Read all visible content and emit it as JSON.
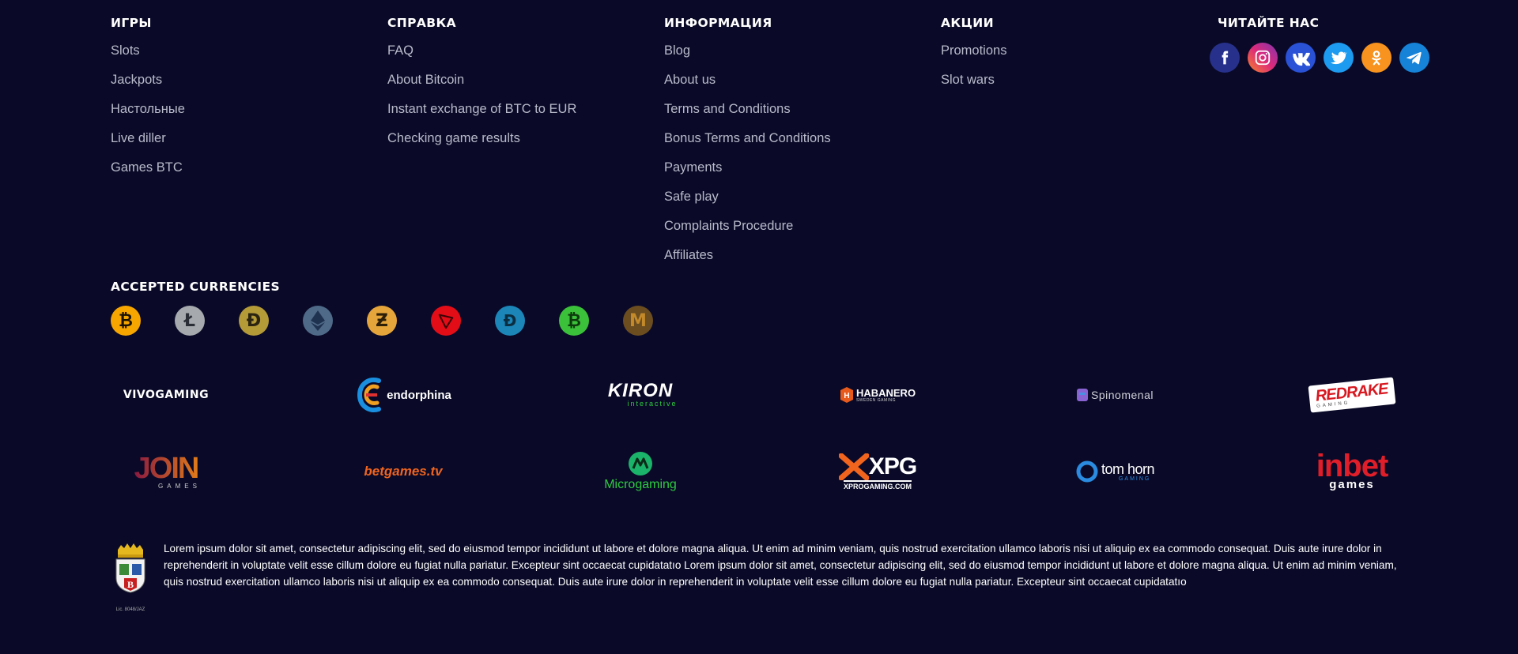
{
  "footer": {
    "games": {
      "title": "ИГРЫ",
      "links": [
        "Slots",
        "Jackpots",
        "Настольные",
        "Live diller",
        "Games BTC"
      ]
    },
    "help": {
      "title": "СПРАВКА",
      "links": [
        "FAQ",
        "About Bitcoin",
        "Instant exchange of BTC to EUR",
        "Checking game results"
      ]
    },
    "info": {
      "title": "ИНФОРМАЦИЯ",
      "links": [
        "Blog",
        "About us",
        "Terms and Conditions",
        "Bonus Terms and Conditions",
        "Payments",
        "Safe play",
        "Complaints Procedure",
        "Affiliates"
      ]
    },
    "promo": {
      "title": "АКЦИИ",
      "links": [
        "Promotions",
        "Slot wars"
      ]
    },
    "social": {
      "title": "ЧИТАЙТЕ НАС",
      "icons": [
        {
          "name": "facebook-icon",
          "color": "#27318b",
          "glyph": "f"
        },
        {
          "name": "instagram-icon",
          "color": "#dc2a7b",
          "glyph": "◎"
        },
        {
          "name": "vk-icon",
          "color": "#2a52d6",
          "glyph": "vk"
        },
        {
          "name": "twitter-icon",
          "color": "#1d9bf0",
          "glyph": "🐦"
        },
        {
          "name": "odnoklassniki-icon",
          "color": "#f7931e",
          "glyph": "ok"
        },
        {
          "name": "telegram-icon",
          "color": "#1683d8",
          "glyph": "➤"
        }
      ]
    }
  },
  "currencies": {
    "title": "ACCEPTED CURRENCIES",
    "coins": [
      {
        "name": "bitcoin-icon",
        "color": "#f7a600",
        "glyph": "₿",
        "fg": "#1a1200"
      },
      {
        "name": "litecoin-icon",
        "color": "#a6a9ad",
        "glyph": "Ł",
        "fg": "#2a2d35"
      },
      {
        "name": "dogecoin-icon",
        "color": "#b59a38",
        "glyph": "Đ",
        "fg": "#2b2410"
      },
      {
        "name": "ethereum-icon",
        "color": "#627eea",
        "glyph": "◆",
        "fg": "#1b2750"
      },
      {
        "name": "zcash-icon",
        "color": "#e6a53a",
        "glyph": "Ƶ",
        "fg": "#2d1f08"
      },
      {
        "name": "tron-icon",
        "color": "#e30d18",
        "glyph": "▽",
        "fg": "#3a0406"
      },
      {
        "name": "dash-icon",
        "color": "#1c86b9",
        "glyph": "Đ",
        "fg": "#0a2e40"
      },
      {
        "name": "bitcoin-cash-icon",
        "color": "#3bc13a",
        "glyph": "₿",
        "fg": "#0d3a0d"
      },
      {
        "name": "monero-icon",
        "color": "#6b4d20",
        "glyph": "M",
        "fg": "#c48a2a"
      }
    ]
  },
  "providers": {
    "row1": [
      "VIVOGAMING",
      "endorphina",
      "KIRON",
      "HABANERO",
      "Spinomenal",
      "REDRAKE"
    ],
    "row1_sub": [
      "",
      "",
      "interactive",
      "SWEDEN GAMING",
      "",
      "GAMING"
    ],
    "row2": [
      "JOIN",
      "betgames.tv",
      "Microgaming",
      "XPG",
      "tom horn",
      "inbet"
    ],
    "row2_sub": [
      "GAMES",
      "",
      "",
      "XPROGAMING.COM",
      "GAMING",
      "games"
    ]
  },
  "crest": {
    "label": "Lic. 8048/JAZ"
  },
  "legal_text": "Lorem ipsum dolor sit amet, consectetur adipiscing elit, sed do eiusmod tempor incididunt ut labore et dolore magna aliqua. Ut enim ad minim veniam, quis nostrud exercitation ullamco laboris nisi ut aliquip ex ea commodo consequat. Duis aute irure dolor in reprehenderit in voluptate velit esse cillum dolore eu fugiat nulla pariatur. Excepteur sint occaecat cupidatatıo Lorem ipsum dolor sit amet, consectetur adipiscing elit, sed do eiusmod tempor incididunt ut labore et dolore magna aliqua. Ut enim ad minim veniam, quis nostrud exercitation ullamco laboris nisi ut aliquip ex ea commodo consequat. Duis aute irure dolor in reprehenderit in voluptate velit esse cillum dolore eu fugiat nulla pariatur. Excepteur sint occaecat cupidatatıo"
}
